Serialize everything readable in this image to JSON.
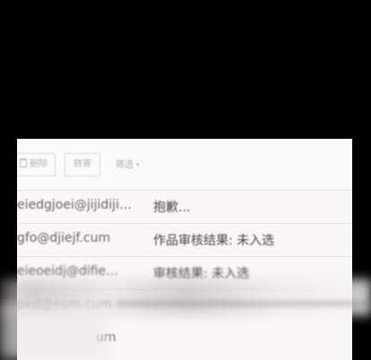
{
  "toolbar": {
    "delete_label": "删除",
    "forward_label": "转寄",
    "filter_label": "筛选",
    "filter_chevron": "▾"
  },
  "messages": [
    {
      "sender": "eiedgjoei@jijidiji…",
      "subject": "抱歉..."
    },
    {
      "sender": "gfo@djiejf.cum",
      "subject": "作品审核结果: 未入选"
    },
    {
      "sender": "eieoeidj@difie…",
      "subject": "审核结果: 未入选"
    },
    {
      "sender": "ped@eom.cum",
      "subject": ""
    },
    {
      "sender": "um",
      "subject": ""
    }
  ],
  "colors": {
    "background": "#000000",
    "panel": "#f8f6f7",
    "text": "#4a4347"
  }
}
